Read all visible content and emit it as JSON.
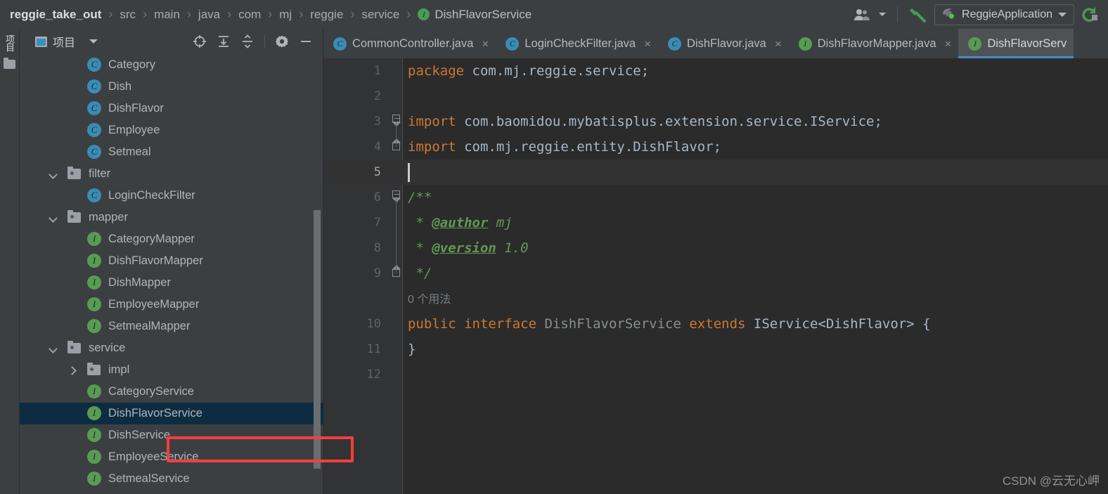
{
  "navbar": {
    "breadcrumbs": [
      {
        "label": "reggie_take_out",
        "icon": null
      },
      {
        "label": "src",
        "icon": null
      },
      {
        "label": "main",
        "icon": null
      },
      {
        "label": "java",
        "icon": null
      },
      {
        "label": "com",
        "icon": null
      },
      {
        "label": "mj",
        "icon": null
      },
      {
        "label": "reggie",
        "icon": null
      },
      {
        "label": "service",
        "icon": null
      },
      {
        "label": "DishFlavorService",
        "icon": "interface-icon",
        "icon_letter": "I"
      }
    ],
    "separator": "›",
    "user_icon": "user-group-icon",
    "build_icon": "build-hammer-icon",
    "run_config": {
      "name": "ReggieApplication",
      "icon": "spring-boot-icon",
      "dropdown_icon": "chevron-down-icon"
    },
    "rerun_icon": "rerun-icon"
  },
  "tool_strip": {
    "project_label": "项目",
    "folder_icon": "folder-icon"
  },
  "project_panel": {
    "title": "项目",
    "window_icon": "project-window-icon",
    "dropdown_icon": "chevron-down-icon",
    "tools": [
      {
        "name": "locate-target-icon",
        "title": "Select Opened File"
      },
      {
        "name": "expand-all-icon",
        "title": "Expand All"
      },
      {
        "name": "collapse-all-icon",
        "title": "Collapse All"
      },
      {
        "name": "settings-gear-icon",
        "title": "Settings"
      },
      {
        "name": "hide-panel-icon",
        "title": "Hide"
      }
    ],
    "tree": [
      {
        "label": "Category",
        "type": "class",
        "indent": 3,
        "twisty": "none",
        "selected": false
      },
      {
        "label": "Dish",
        "type": "class",
        "indent": 3,
        "twisty": "none",
        "selected": false
      },
      {
        "label": "DishFlavor",
        "type": "class",
        "indent": 3,
        "twisty": "none",
        "selected": false
      },
      {
        "label": "Employee",
        "type": "class",
        "indent": 3,
        "twisty": "none",
        "selected": false
      },
      {
        "label": "Setmeal",
        "type": "class",
        "indent": 3,
        "twisty": "none",
        "selected": false
      },
      {
        "label": "filter",
        "type": "folder",
        "indent": 2,
        "twisty": "expanded",
        "selected": false
      },
      {
        "label": "LoginCheckFilter",
        "type": "class",
        "indent": 3,
        "twisty": "none",
        "selected": false
      },
      {
        "label": "mapper",
        "type": "folder",
        "indent": 2,
        "twisty": "expanded",
        "selected": false
      },
      {
        "label": "CategoryMapper",
        "type": "interface",
        "indent": 3,
        "twisty": "none",
        "selected": false
      },
      {
        "label": "DishFlavorMapper",
        "type": "interface",
        "indent": 3,
        "twisty": "none",
        "selected": false
      },
      {
        "label": "DishMapper",
        "type": "interface",
        "indent": 3,
        "twisty": "none",
        "selected": false
      },
      {
        "label": "EmployeeMapper",
        "type": "interface",
        "indent": 3,
        "twisty": "none",
        "selected": false
      },
      {
        "label": "SetmealMapper",
        "type": "interface",
        "indent": 3,
        "twisty": "none",
        "selected": false
      },
      {
        "label": "service",
        "type": "folder",
        "indent": 2,
        "twisty": "expanded",
        "selected": false
      },
      {
        "label": "impl",
        "type": "folder",
        "indent": 3,
        "twisty": "collapsed",
        "selected": false
      },
      {
        "label": "CategoryService",
        "type": "interface",
        "indent": 3,
        "twisty": "none",
        "selected": false
      },
      {
        "label": "DishFlavorService",
        "type": "interface",
        "indent": 3,
        "twisty": "none",
        "selected": true
      },
      {
        "label": "DishService",
        "type": "interface",
        "indent": 3,
        "twisty": "none",
        "selected": false
      },
      {
        "label": "EmployeeService",
        "type": "interface",
        "indent": 3,
        "twisty": "none",
        "selected": false
      },
      {
        "label": "SetmealService",
        "type": "interface",
        "indent": 3,
        "twisty": "none",
        "selected": false
      }
    ],
    "annotation": {
      "shape": "rectangle",
      "color": "#fc3d3d",
      "target": "DishFlavorService"
    }
  },
  "editor": {
    "tabs": [
      {
        "label": "CommonController.java",
        "type": "class",
        "active": false,
        "close": "×"
      },
      {
        "label": "LoginCheckFilter.java",
        "type": "class",
        "active": false,
        "close": "×"
      },
      {
        "label": "DishFlavor.java",
        "type": "class",
        "active": false,
        "close": "×"
      },
      {
        "label": "DishFlavorMapper.java",
        "type": "interface",
        "active": false,
        "close": "×"
      },
      {
        "label": "DishFlavorServ",
        "type": "interface",
        "active": true,
        "close": ""
      }
    ],
    "lines": [
      {
        "num": "1",
        "current": false,
        "fold": "",
        "tokens": [
          {
            "t": "package ",
            "c": "kw"
          },
          {
            "t": "com.mj.reggie.service;",
            "c": "id"
          }
        ]
      },
      {
        "num": "2",
        "current": false,
        "fold": "",
        "tokens": []
      },
      {
        "num": "3",
        "current": false,
        "fold": "start",
        "tokens": [
          {
            "t": "import ",
            "c": "kw"
          },
          {
            "t": "com.baomidou.mybatisplus.extension.service.IService;",
            "c": "id"
          }
        ]
      },
      {
        "num": "4",
        "current": false,
        "fold": "end",
        "tokens": [
          {
            "t": "import ",
            "c": "kw"
          },
          {
            "t": "com.mj.reggie.entity.DishFlavor;",
            "c": "id"
          }
        ]
      },
      {
        "num": "5",
        "current": true,
        "fold": "",
        "tokens": []
      },
      {
        "num": "6",
        "current": false,
        "fold": "start",
        "tokens": [
          {
            "t": "/**",
            "c": "cmt"
          }
        ]
      },
      {
        "num": "7",
        "current": false,
        "fold": "",
        "tokens": [
          {
            "t": " * ",
            "c": "cmt"
          },
          {
            "t": "@author",
            "c": "tag"
          },
          {
            "t": " mj",
            "c": "cmt"
          }
        ]
      },
      {
        "num": "8",
        "current": false,
        "fold": "",
        "tokens": [
          {
            "t": " * ",
            "c": "cmt"
          },
          {
            "t": "@version",
            "c": "tag"
          },
          {
            "t": " 1.0",
            "c": "cmt"
          }
        ]
      },
      {
        "num": "9",
        "current": false,
        "fold": "end",
        "tokens": [
          {
            "t": " */",
            "c": "cmt"
          }
        ]
      },
      {
        "num": "",
        "current": false,
        "fold": "",
        "tokens": [
          {
            "t": "0 个用法",
            "c": "hint"
          }
        ]
      },
      {
        "num": "10",
        "current": false,
        "fold": "",
        "tokens": [
          {
            "t": "public ",
            "c": "kw"
          },
          {
            "t": "interface ",
            "c": "kw"
          },
          {
            "t": "DishFlavorService",
            "c": "cls"
          },
          {
            "t": " ",
            "c": "id"
          },
          {
            "t": "extends ",
            "c": "kw"
          },
          {
            "t": "IService<DishFlavor> {",
            "c": "id"
          }
        ]
      },
      {
        "num": "11",
        "current": false,
        "fold": "",
        "tokens": [
          {
            "t": "}",
            "c": "id"
          }
        ]
      },
      {
        "num": "12",
        "current": false,
        "fold": "",
        "tokens": []
      }
    ]
  },
  "watermark": "CSDN @云无心岬",
  "colors": {
    "background": "#3c3f41",
    "editor_background": "#2b2b2b",
    "selection": "#0d2c41",
    "annotation_red": "#fc3d3d",
    "keyword": "#cc7832",
    "identifier": "#a9b7c6",
    "comment": "#629755",
    "class_icon": "#3b8cb5",
    "interface_icon": "#589c53",
    "tab_underline": "#4a88c7"
  }
}
